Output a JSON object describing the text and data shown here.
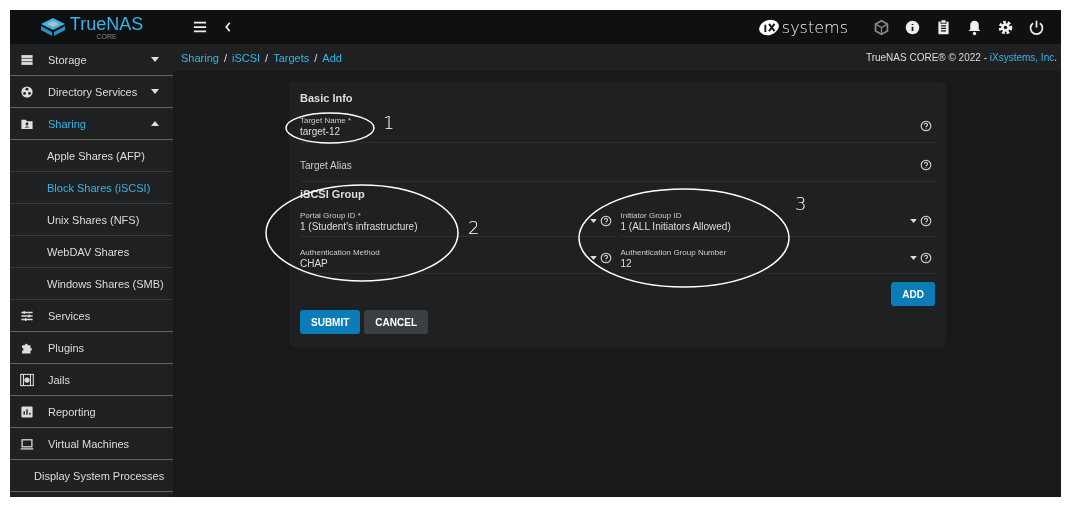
{
  "topbar": {
    "brand": "TrueNAS",
    "brand_sub": "CORE",
    "vendor": "systems"
  },
  "sidebar": {
    "items": [
      {
        "label": "Storage",
        "expanded": false,
        "selected": false
      },
      {
        "label": "Directory Services",
        "expanded": false,
        "selected": false
      },
      {
        "label": "Sharing",
        "expanded": true,
        "selected": true,
        "children": [
          {
            "label": "Apple Shares (AFP)",
            "selected": false
          },
          {
            "label": "Block Shares (iSCSI)",
            "selected": true
          },
          {
            "label": "Unix Shares (NFS)",
            "selected": false
          },
          {
            "label": "WebDAV Shares",
            "selected": false
          },
          {
            "label": "Windows Shares (SMB)",
            "selected": false
          }
        ]
      },
      {
        "label": "Services",
        "selected": false
      },
      {
        "label": "Plugins",
        "selected": false
      },
      {
        "label": "Jails",
        "selected": false
      },
      {
        "label": "Reporting",
        "selected": false
      },
      {
        "label": "Virtual Machines",
        "selected": false
      },
      {
        "label": "Display System Processes",
        "selected": false
      }
    ]
  },
  "breadcrumb": {
    "items": [
      "Sharing",
      "iSCSI",
      "Targets",
      "Add"
    ],
    "separator": "/"
  },
  "copyright": {
    "text": "TrueNAS CORE® © 2022 - ",
    "link": "iXsystems, Inc",
    "end": "."
  },
  "form": {
    "basic_title": "Basic Info",
    "fields": [
      {
        "label": "Target Name *",
        "value": "target-12"
      },
      {
        "placeholder": "Target Alias"
      }
    ],
    "group_title": "iSCSI Group",
    "group_fields": [
      {
        "label": "Portal Group ID *",
        "value": "1 (Student's infrastructure)"
      },
      {
        "label": "Initiator Group ID",
        "value": "1 (ALL Initiators Allowed)"
      },
      {
        "label": "Authentication Method",
        "value": "CHAP"
      },
      {
        "label": "Authentication Group Number",
        "value": "12"
      }
    ],
    "add_button": "ADD",
    "submit_button": "SUBMIT",
    "cancel_button": "CANCEL"
  },
  "annotations": [
    "1",
    "2",
    "3"
  ]
}
